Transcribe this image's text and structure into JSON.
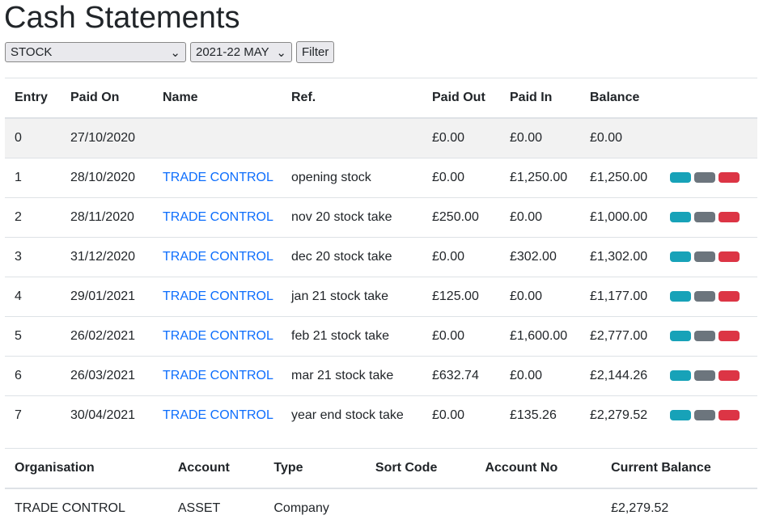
{
  "title": "Cash Statements",
  "filters": {
    "account": "STOCK",
    "period": "2021-22 MAY",
    "filter_label": "Filter"
  },
  "colors": {
    "info": "#17a2b8",
    "secondary": "#6c757d",
    "danger": "#dc3545",
    "link": "#0d6efd"
  },
  "statement": {
    "headers": [
      "Entry",
      "Paid On",
      "Name",
      "Ref.",
      "Paid Out",
      "Paid In",
      "Balance"
    ],
    "rows": [
      [
        "0",
        "27/10/2020",
        "",
        "",
        "£0.00",
        "£0.00",
        "£0.00"
      ],
      [
        "1",
        "28/10/2020",
        "TRADE CONTROL",
        "opening stock",
        "£0.00",
        "£1,250.00",
        "£1,250.00"
      ],
      [
        "2",
        "28/11/2020",
        "TRADE CONTROL",
        "nov 20 stock take",
        "£250.00",
        "£0.00",
        "£1,000.00"
      ],
      [
        "3",
        "31/12/2020",
        "TRADE CONTROL",
        "dec 20 stock take",
        "£0.00",
        "£302.00",
        "£1,302.00"
      ],
      [
        "4",
        "29/01/2021",
        "TRADE CONTROL",
        "jan 21 stock take",
        "£125.00",
        "£0.00",
        "£1,177.00"
      ],
      [
        "5",
        "26/02/2021",
        "TRADE CONTROL",
        "feb 21 stock take",
        "£0.00",
        "£1,600.00",
        "£2,777.00"
      ],
      [
        "6",
        "26/03/2021",
        "TRADE CONTROL",
        "mar 21 stock take",
        "£632.74",
        "£0.00",
        "£2,144.26"
      ],
      [
        "7",
        "30/04/2021",
        "TRADE CONTROL",
        "year end stock take",
        "£0.00",
        "£135.26",
        "£2,279.52"
      ]
    ]
  },
  "account": {
    "headers": [
      "Organisation",
      "Account",
      "Type",
      "Sort Code",
      "Account No",
      "Current Balance"
    ],
    "row": [
      "TRADE CONTROL",
      "ASSET",
      "Company",
      "",
      "",
      "£2,279.52"
    ]
  }
}
